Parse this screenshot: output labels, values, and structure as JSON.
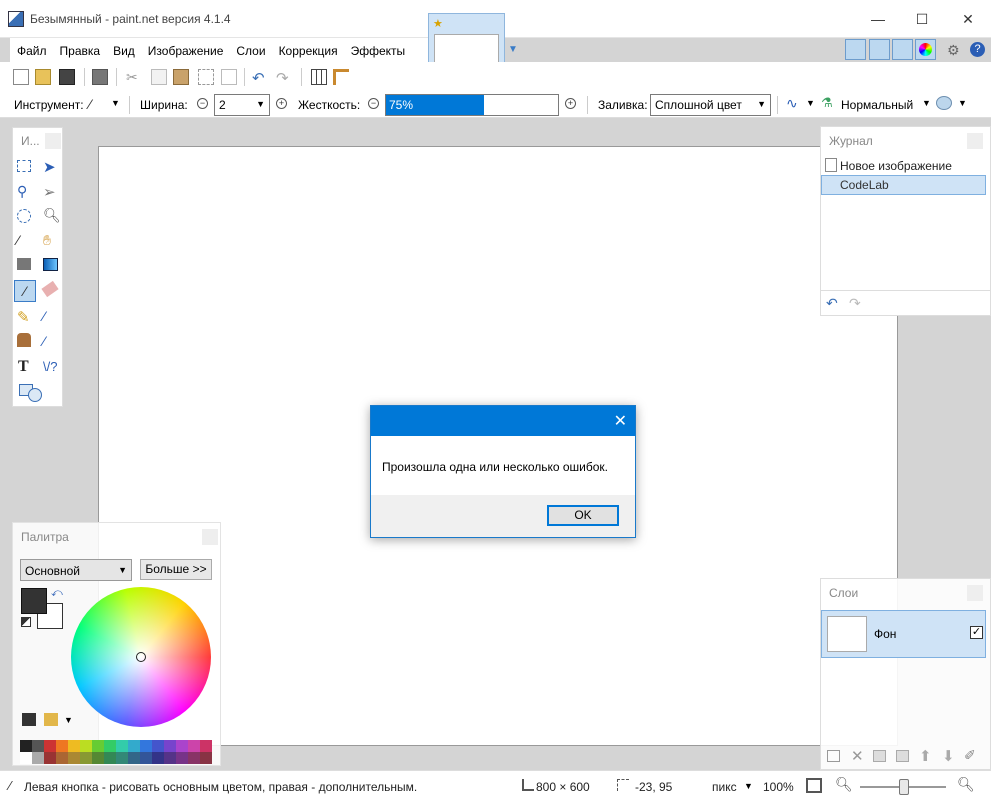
{
  "app": {
    "title": "Безымянный - paint.net версия 4.1.4",
    "window_buttons": [
      "—",
      "☐",
      "✕"
    ]
  },
  "menu": {
    "items": [
      "Файл",
      "Правка",
      "Вид",
      "Изображение",
      "Слои",
      "Коррекция",
      "Эффекты"
    ]
  },
  "options": {
    "tool_label": "Инструмент:",
    "width_label": "Ширина:",
    "width_value": "2",
    "hardness_label": "Жесткость:",
    "hardness_value": "75%",
    "hardness_fraction": 0.75,
    "fill_label": "Заливка:",
    "fill_value": "Сплошной цвет",
    "blend_value": "Нормальный"
  },
  "tools_panel": {
    "title": "И..."
  },
  "palette": {
    "title": "Палитра",
    "mode": "Основной",
    "more_button": "Больше >>",
    "primary_color": "#333333",
    "secondary_color": "#ffffff",
    "swatches_row1": [
      "#222222",
      "#555555",
      "#cc3333",
      "#ee7722",
      "#eebb22",
      "#bbdd22",
      "#66cc33",
      "#33cc66",
      "#33ccaa",
      "#33aacc",
      "#3377dd",
      "#4455cc",
      "#7744cc",
      "#aa44cc",
      "#cc44aa",
      "#cc3366"
    ],
    "swatches_row2": [
      "#ffffff",
      "#aaaaaa",
      "#993333",
      "#aa6633",
      "#aa8833",
      "#889933",
      "#558833",
      "#338855",
      "#338877",
      "#336688",
      "#335599",
      "#333388",
      "#553388",
      "#773388",
      "#883366",
      "#883344"
    ]
  },
  "history": {
    "title": "Журнал",
    "items": [
      "Новое изображение",
      "CodeLab"
    ]
  },
  "layers": {
    "title": "Слои",
    "layer_name": "Фон"
  },
  "dialog": {
    "close_glyph": "✕",
    "message": "Произошла одна или несколько ошибок.",
    "ok": "OK"
  },
  "status": {
    "hint": "Левая кнопка - рисовать основным цветом, правая - дополнительным.",
    "size": "800 × 600",
    "coords": "-23, 95",
    "units": "пикс",
    "zoom": "100%"
  }
}
